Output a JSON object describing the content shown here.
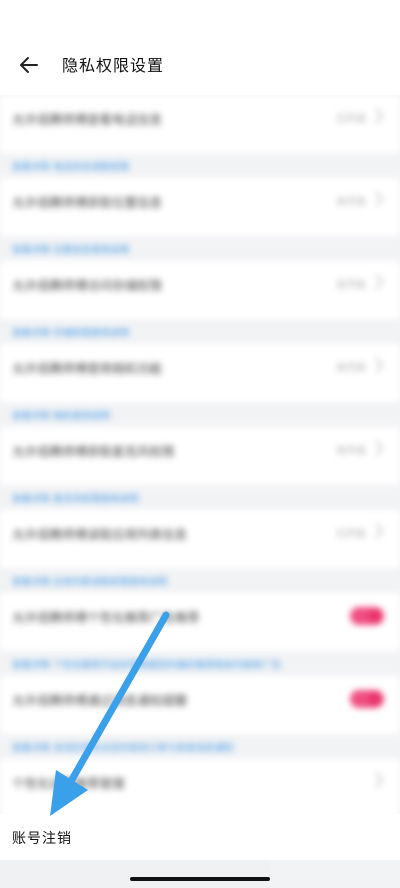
{
  "header": {
    "title": "隐私权限设置",
    "back_icon": "arrow-left-icon"
  },
  "settings": [
    {
      "title": "允许佰腾师傅查看电话信息",
      "status": "已开启",
      "control": "chevron",
      "desc": "查看详情  电话状态读取权限"
    },
    {
      "title": "允许佰腾师傅获取位置信息",
      "status": "未开启",
      "control": "chevron",
      "desc": "查看详情  位置信息使用说明"
    },
    {
      "title": "允许佰腾师傅访问存储权限",
      "status": "未开启",
      "control": "chevron",
      "desc": "查看详情  存储权限使用说明"
    },
    {
      "title": "允许佰腾师傅使用相机功能",
      "status": "未开启",
      "control": "chevron",
      "desc": "查看详情  相机使用说明"
    },
    {
      "title": "允许佰腾师傅获取麦克风权限",
      "status": "未开启",
      "control": "chevron",
      "desc": "查看详情  麦克风权限使用说明"
    },
    {
      "title": "允许佰腾师傅读取应用列表信息",
      "status": "已开启",
      "control": "chevron",
      "desc": "查看详情  应用列表读取权限使用说明"
    },
    {
      "title": "允许佰腾师傅个性化推荐广告推荐",
      "status": "",
      "control": "toggle",
      "desc": "查看详情  个性化推荐开启后将根据您的偏好推荐相关内容和广告"
    },
    {
      "title": "允许佰腾师傅通过消息通知提醒",
      "status": "",
      "control": "toggle",
      "desc": "查看详情  关闭后将无法及时收到订单与系统消息通知"
    },
    {
      "title": "个性化设置推荐管理",
      "status": "",
      "control": "chevron-only",
      "desc": ""
    }
  ],
  "account": {
    "label": "账号注销"
  },
  "colors": {
    "accent_blue": "#3b95e6",
    "toggle_pink": "#f04f82",
    "annotation_arrow": "#3aa0ea"
  },
  "overlay": {
    "arrow_icon": "annotation-arrow-icon"
  }
}
